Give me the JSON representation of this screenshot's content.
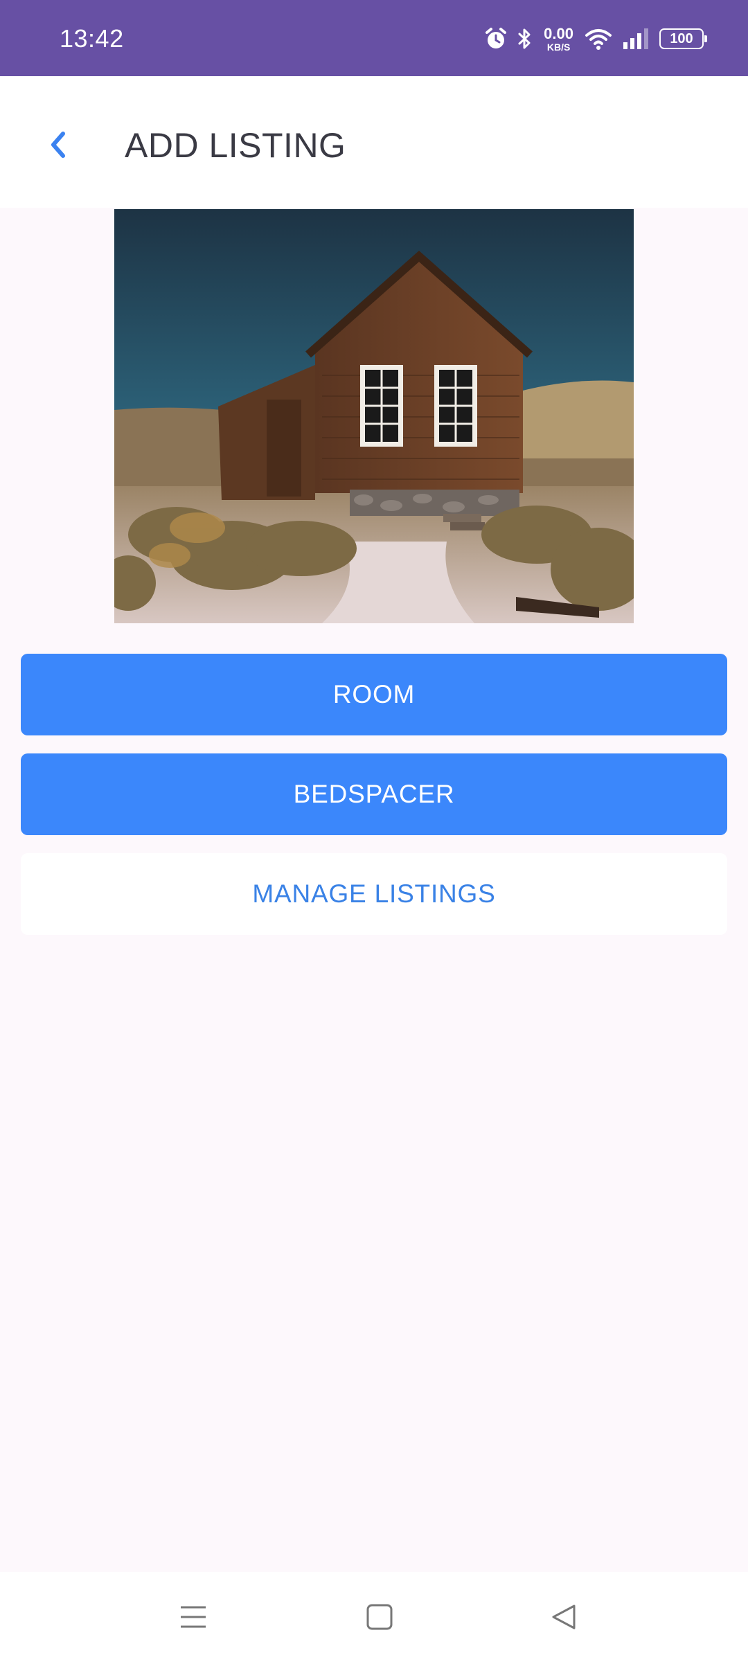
{
  "status_bar": {
    "time": "13:42",
    "net_speed_value": "0.00",
    "net_speed_unit": "KB/S",
    "battery": "100",
    "icons": [
      "alarm-icon",
      "bluetooth-icon",
      "wifi-icon",
      "signal-icon",
      "battery-icon"
    ]
  },
  "header": {
    "back_icon": "chevron-left-icon",
    "title": "ADD LISTING"
  },
  "hero_image": {
    "subject": "wooden cabin"
  },
  "actions": {
    "room_label": "ROOM",
    "bedspacer_label": "BEDSPACER",
    "manage_label": "MANAGE LISTINGS"
  },
  "nav_bar": {
    "icons": [
      "menu-icon",
      "home-icon",
      "back-icon"
    ]
  },
  "colors": {
    "status_bar": "#6750a4",
    "primary_button": "#3b87fb",
    "link_text": "#3a82e6",
    "background": "#fdf8fc"
  }
}
